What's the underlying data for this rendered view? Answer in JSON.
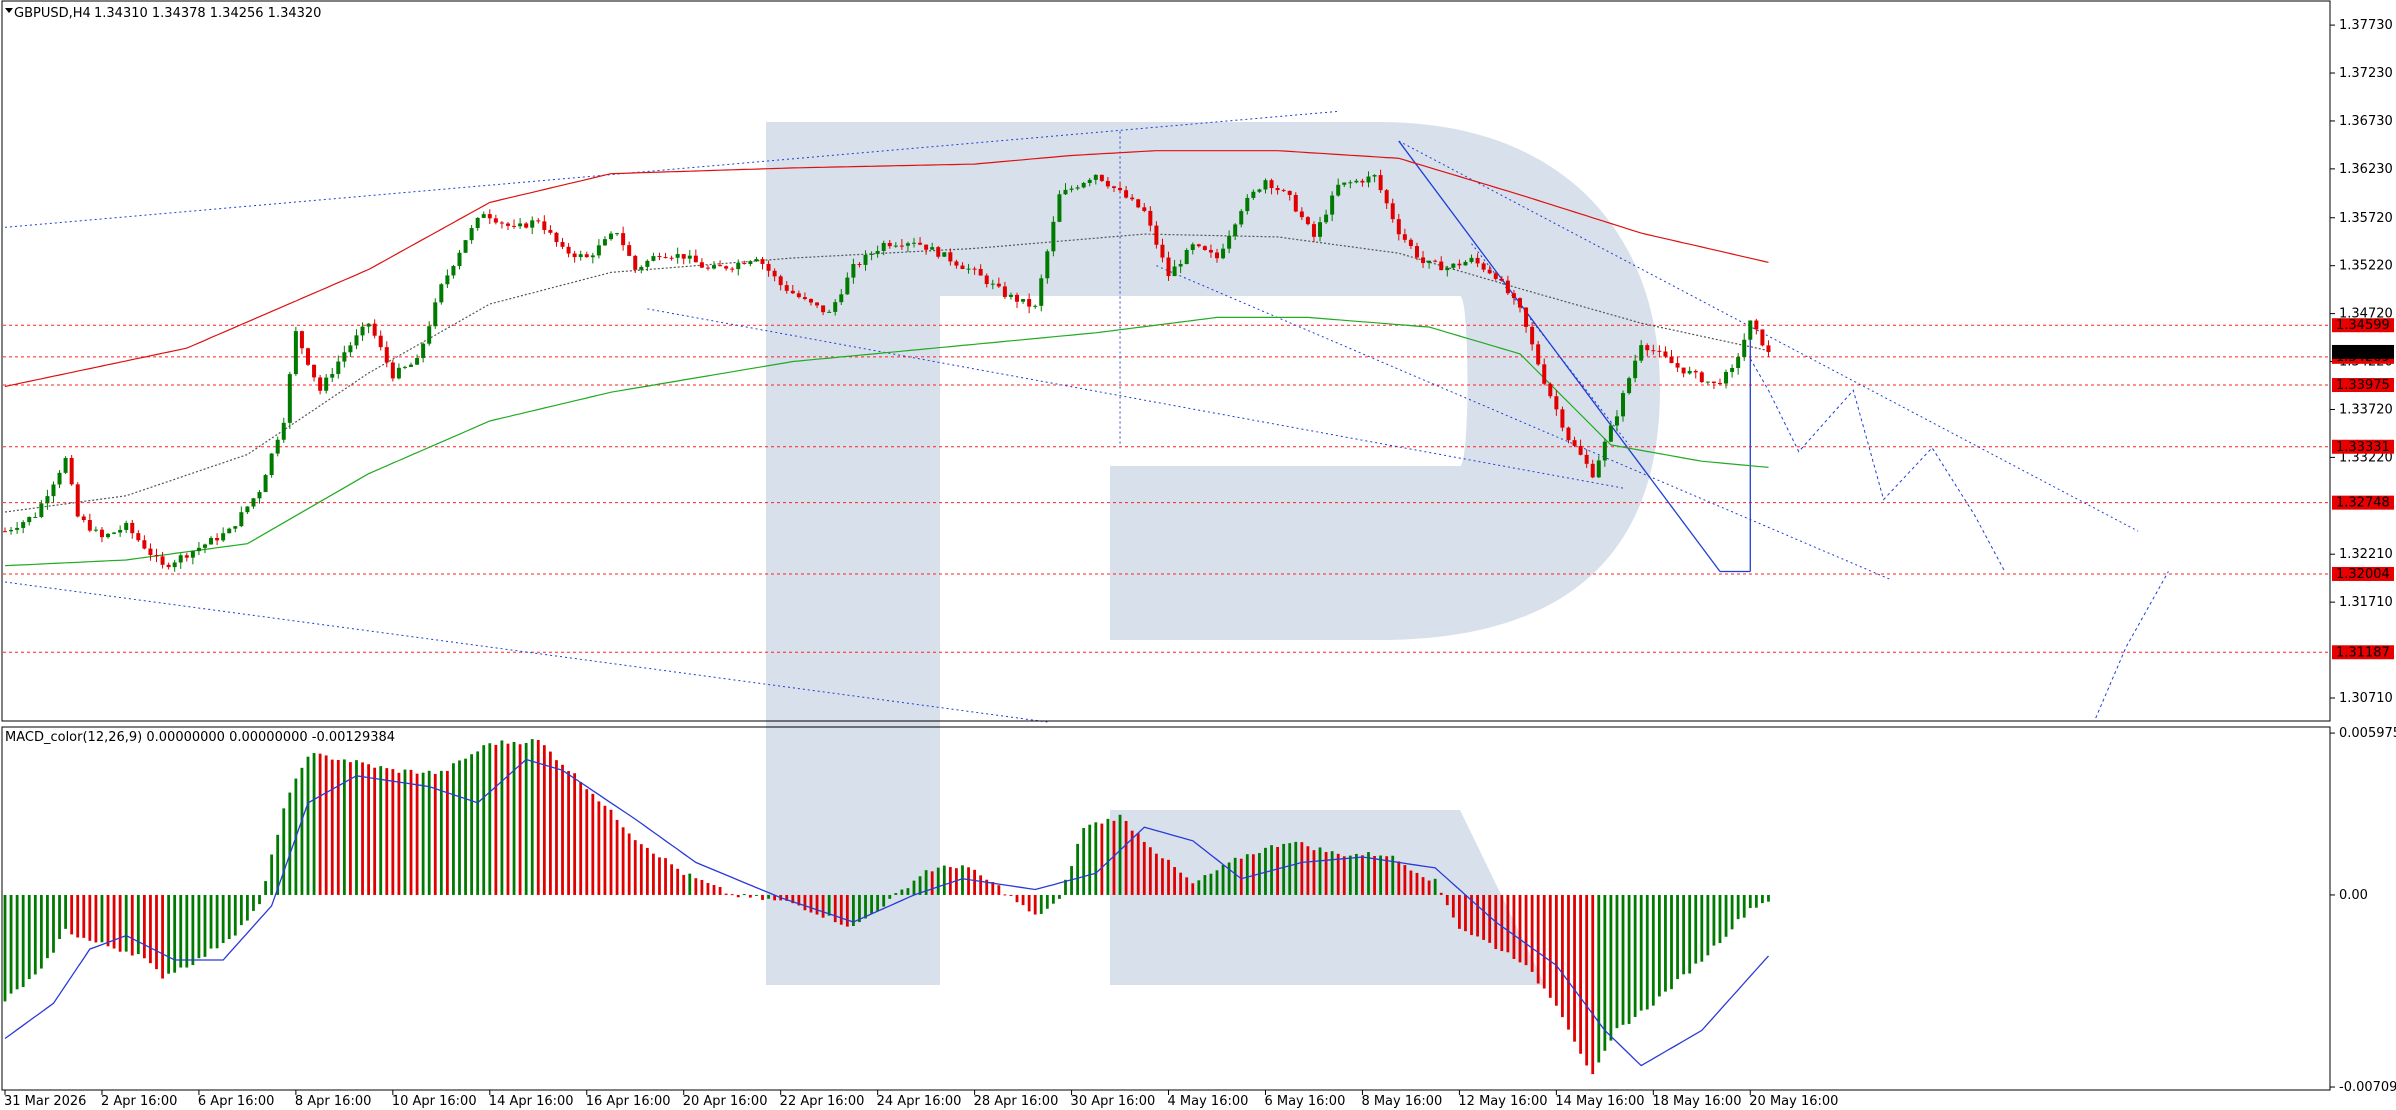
{
  "header": {
    "symbol": "GBPUSD,H4",
    "ohlc": "1.34310 1.34378 1.34256 1.34320",
    "macd_label": "MACD_color(12,26,9) 0.00000000 0.00000000 -0.00129384"
  },
  "colors": {
    "bull": "#007a00",
    "bear": "#e00000",
    "ma_slow": "#dd1111",
    "ma_mid": "#22aa22",
    "ma_dash": "#555555",
    "trend": "#1f3fd6",
    "level": "#ff2020",
    "signal": "#2a3ad8",
    "watermark": "#d6dfea"
  },
  "chart_data": [
    {
      "type": "candlestick",
      "name": "price",
      "ylim": [
        1.3047,
        1.3795
      ],
      "y_ticks": [
        "1.37730",
        "1.37230",
        "1.36730",
        "1.36230",
        "1.35720",
        "1.35220",
        "1.34720",
        "1.34220",
        "1.33720",
        "1.33220",
        "1.32210",
        "1.31710",
        "1.30710"
      ],
      "y_tick_values": [
        1.3773,
        1.3723,
        1.3673,
        1.3623,
        1.3572,
        1.3522,
        1.3472,
        1.3422,
        1.3372,
        1.3322,
        1.3221,
        1.3171,
        1.3071
      ],
      "x_ticks": [
        "31 Mar 2026",
        "2 Apr 16:00",
        "6 Apr 16:00",
        "8 Apr 16:00",
        "10 Apr 16:00",
        "14 Apr 16:00",
        "16 Apr 16:00",
        "20 Apr 16:00",
        "22 Apr 16:00",
        "24 Apr 16:00",
        "28 Apr 16:00",
        "30 Apr 16:00",
        "4 May 16:00",
        "6 May 16:00",
        "8 May 16:00",
        "12 May 16:00",
        "14 May 16:00",
        "18 May 16:00",
        "20 May 16:00"
      ],
      "x_tick_bars": [
        0,
        16,
        32,
        48,
        64,
        80,
        96,
        112,
        128,
        144,
        160,
        176,
        192,
        208,
        224,
        240,
        256,
        272,
        288
      ],
      "bars_count": 292,
      "price_levels": [
        {
          "label": "1.34599",
          "value": 1.34599
        },
        {
          "label": "1.34269",
          "value": 1.34269
        },
        {
          "label": "1.33975",
          "value": 1.33975
        },
        {
          "label": "1.33331",
          "value": 1.33331
        },
        {
          "label": "1.32748",
          "value": 1.32748
        },
        {
          "label": "1.32004",
          "value": 1.32004
        },
        {
          "label": "1.31187",
          "value": 1.31187
        }
      ],
      "current_price": {
        "label": "1.34320",
        "value": 1.3432
      },
      "anchors": [
        [
          0,
          1.3245
        ],
        [
          5,
          1.3262
        ],
        [
          10,
          1.332
        ],
        [
          12,
          1.326
        ],
        [
          16,
          1.3238
        ],
        [
          20,
          1.325
        ],
        [
          26,
          1.3208
        ],
        [
          32,
          1.3228
        ],
        [
          37,
          1.3245
        ],
        [
          42,
          1.3288
        ],
        [
          46,
          1.3362
        ],
        [
          48,
          1.3452
        ],
        [
          52,
          1.3392
        ],
        [
          56,
          1.3432
        ],
        [
          60,
          1.3462
        ],
        [
          64,
          1.3408
        ],
        [
          68,
          1.3422
        ],
        [
          72,
          1.35
        ],
        [
          76,
          1.355
        ],
        [
          79,
          1.3578
        ],
        [
          84,
          1.356
        ],
        [
          88,
          1.357
        ],
        [
          92,
          1.3538
        ],
        [
          96,
          1.353
        ],
        [
          101,
          1.3558
        ],
        [
          104,
          1.3518
        ],
        [
          108,
          1.3535
        ],
        [
          112,
          1.3532
        ],
        [
          116,
          1.3518
        ],
        [
          120,
          1.3522
        ],
        [
          124,
          1.3532
        ],
        [
          128,
          1.3502
        ],
        [
          132,
          1.3485
        ],
        [
          136,
          1.3472
        ],
        [
          140,
          1.352
        ],
        [
          145,
          1.3545
        ],
        [
          150,
          1.3548
        ],
        [
          155,
          1.3532
        ],
        [
          160,
          1.3515
        ],
        [
          165,
          1.3492
        ],
        [
          170,
          1.3478
        ],
        [
          174,
          1.3595
        ],
        [
          180,
          1.3618
        ],
        [
          184,
          1.3598
        ],
        [
          188,
          1.3578
        ],
        [
          192,
          1.3512
        ],
        [
          196,
          1.3542
        ],
        [
          200,
          1.353
        ],
        [
          204,
          1.3582
        ],
        [
          208,
          1.3612
        ],
        [
          212,
          1.3592
        ],
        [
          216,
          1.3552
        ],
        [
          220,
          1.3605
        ],
        [
          226,
          1.3615
        ],
        [
          230,
          1.3558
        ],
        [
          234,
          1.3525
        ],
        [
          238,
          1.352
        ],
        [
          242,
          1.3528
        ],
        [
          246,
          1.3512
        ],
        [
          250,
          1.3475
        ],
        [
          254,
          1.3402
        ],
        [
          258,
          1.3342
        ],
        [
          262,
          1.3305
        ],
        [
          266,
          1.3368
        ],
        [
          270,
          1.3442
        ],
        [
          276,
          1.3416
        ],
        [
          282,
          1.3398
        ],
        [
          285,
          1.3412
        ],
        [
          288,
          1.3462
        ],
        [
          291,
          1.3432
        ]
      ],
      "ma_slow_anchors": [
        [
          0,
          1.3396
        ],
        [
          30,
          1.3436
        ],
        [
          60,
          1.3518
        ],
        [
          80,
          1.3588
        ],
        [
          100,
          1.3618
        ],
        [
          130,
          1.3624
        ],
        [
          160,
          1.3628
        ],
        [
          176,
          1.3637
        ],
        [
          190,
          1.3642
        ],
        [
          210,
          1.3642
        ],
        [
          230,
          1.3634
        ],
        [
          250,
          1.3596
        ],
        [
          270,
          1.3556
        ],
        [
          292,
          1.3524
        ]
      ],
      "ma_mid_anchors": [
        [
          0,
          1.3209
        ],
        [
          20,
          1.3215
        ],
        [
          40,
          1.3232
        ],
        [
          60,
          1.3305
        ],
        [
          80,
          1.336
        ],
        [
          100,
          1.339
        ],
        [
          130,
          1.3422
        ],
        [
          160,
          1.344
        ],
        [
          180,
          1.3452
        ],
        [
          200,
          1.3468
        ],
        [
          215,
          1.3468
        ],
        [
          235,
          1.3458
        ],
        [
          250,
          1.343
        ],
        [
          265,
          1.3335
        ],
        [
          280,
          1.3318
        ],
        [
          292,
          1.3311
        ]
      ],
      "ma_dash_anchors": [
        [
          0,
          1.3265
        ],
        [
          20,
          1.3282
        ],
        [
          40,
          1.3325
        ],
        [
          60,
          1.341
        ],
        [
          80,
          1.3482
        ],
        [
          100,
          1.3515
        ],
        [
          130,
          1.353
        ],
        [
          160,
          1.354
        ],
        [
          188,
          1.3555
        ],
        [
          210,
          1.3552
        ],
        [
          230,
          1.3535
        ],
        [
          250,
          1.3498
        ],
        [
          270,
          1.3462
        ],
        [
          292,
          1.3432
        ]
      ],
      "projection": [
        [
          288,
          1.3425
        ],
        [
          291,
          1.3392
        ],
        [
          296,
          1.3328
        ],
        [
          305,
          1.3392
        ],
        [
          310,
          1.3278
        ],
        [
          318,
          1.3332
        ],
        [
          325,
          1.3262
        ],
        [
          330,
          1.3203
        ]
      ],
      "projection2": [
        [
          345,
          1.305
        ],
        [
          350,
          1.3124
        ],
        [
          357,
          1.3203
        ]
      ],
      "trend_lines": [
        {
          "from": [
            0,
            1.3562
          ],
          "to": [
            220,
            1.3683
          ],
          "style": "dotted"
        },
        {
          "from": [
            106,
            1.3477
          ],
          "to": [
            267,
            1.329
          ],
          "style": "dotted"
        },
        {
          "from": [
            184,
            1.3662
          ],
          "to": [
            184,
            1.3333
          ],
          "style": "dotted"
        },
        {
          "from": [
            230,
            1.3652
          ],
          "to": [
            352,
            1.3245
          ],
          "style": "dotted"
        },
        {
          "from": [
            190,
            1.3522
          ],
          "to": [
            311,
            1.3195
          ],
          "style": "dotted"
        },
        {
          "from": [
            0,
            1.3192
          ],
          "to": [
            172,
            1.3046
          ],
          "style": "dotted"
        },
        {
          "from": [
            230,
            1.3652
          ],
          "to": [
            283,
            1.3203
          ],
          "style": "solid"
        },
        {
          "from": [
            283,
            1.3203
          ],
          "to": [
            288,
            1.3203
          ],
          "style": "solid"
        },
        {
          "from": [
            288,
            1.3203
          ],
          "to": [
            288,
            1.3462
          ],
          "style": "solid"
        },
        {
          "from": [
            242,
            1.3545
          ],
          "to": [
            268,
            1.3335
          ],
          "style": "dotted"
        }
      ]
    },
    {
      "type": "histogram",
      "name": "MACD_color(12,26,9)",
      "ylim": [
        -0.0072,
        0.0062
      ],
      "y_ticks": [
        "0.0059755",
        "0.00",
        "-0.0070902"
      ],
      "y_tick_values": [
        0.0059755,
        0.0,
        -0.0070902
      ],
      "hist_anchors": [
        [
          0,
          -0.0039
        ],
        [
          6,
          -0.0028
        ],
        [
          10,
          -0.0013
        ],
        [
          14,
          -0.0017
        ],
        [
          22,
          -0.0022
        ],
        [
          26,
          -0.003
        ],
        [
          32,
          -0.0024
        ],
        [
          38,
          -0.0014
        ],
        [
          42,
          -0.0004
        ],
        [
          46,
          0.0032
        ],
        [
          50,
          0.0052
        ],
        [
          56,
          0.005
        ],
        [
          64,
          0.0046
        ],
        [
          72,
          0.0045
        ],
        [
          80,
          0.0056
        ],
        [
          88,
          0.0057
        ],
        [
          96,
          0.004
        ],
        [
          104,
          0.0021
        ],
        [
          112,
          0.0008
        ],
        [
          120,
          0.0
        ],
        [
          130,
          -0.0003
        ],
        [
          140,
          -0.0012
        ],
        [
          146,
          -0.0002
        ],
        [
          152,
          0.0009
        ],
        [
          158,
          0.0011
        ],
        [
          164,
          0.0003
        ],
        [
          170,
          -0.0008
        ],
        [
          174,
          -0.0002
        ],
        [
          178,
          0.0025
        ],
        [
          184,
          0.0029
        ],
        [
          190,
          0.0016
        ],
        [
          196,
          0.0004
        ],
        [
          204,
          0.0014
        ],
        [
          212,
          0.002
        ],
        [
          220,
          0.0015
        ],
        [
          228,
          0.0015
        ],
        [
          236,
          0.0005
        ],
        [
          240,
          -0.0012
        ],
        [
          250,
          -0.0024
        ],
        [
          256,
          -0.004
        ],
        [
          262,
          -0.0067
        ],
        [
          266,
          -0.005
        ],
        [
          272,
          -0.004
        ],
        [
          280,
          -0.0024
        ],
        [
          288,
          -0.0005
        ],
        [
          292,
          -0.0001
        ]
      ],
      "signal_anchors": [
        [
          0,
          -0.0053
        ],
        [
          8,
          -0.004
        ],
        [
          14,
          -0.002
        ],
        [
          20,
          -0.0015
        ],
        [
          28,
          -0.0024
        ],
        [
          36,
          -0.0024
        ],
        [
          44,
          -0.0004
        ],
        [
          50,
          0.0034
        ],
        [
          58,
          0.0044
        ],
        [
          70,
          0.004
        ],
        [
          78,
          0.0034
        ],
        [
          86,
          0.005
        ],
        [
          92,
          0.0046
        ],
        [
          104,
          0.0028
        ],
        [
          114,
          0.0012
        ],
        [
          128,
          -0.0001
        ],
        [
          140,
          -0.001
        ],
        [
          150,
          0.0
        ],
        [
          158,
          0.0006
        ],
        [
          170,
          0.0002
        ],
        [
          180,
          0.0008
        ],
        [
          188,
          0.0025
        ],
        [
          196,
          0.002
        ],
        [
          204,
          0.0006
        ],
        [
          214,
          0.0012
        ],
        [
          224,
          0.0014
        ],
        [
          236,
          0.001
        ],
        [
          246,
          -0.001
        ],
        [
          256,
          -0.0026
        ],
        [
          264,
          -0.005
        ],
        [
          270,
          -0.0063
        ],
        [
          280,
          -0.005
        ],
        [
          292,
          -0.002
        ]
      ]
    }
  ]
}
